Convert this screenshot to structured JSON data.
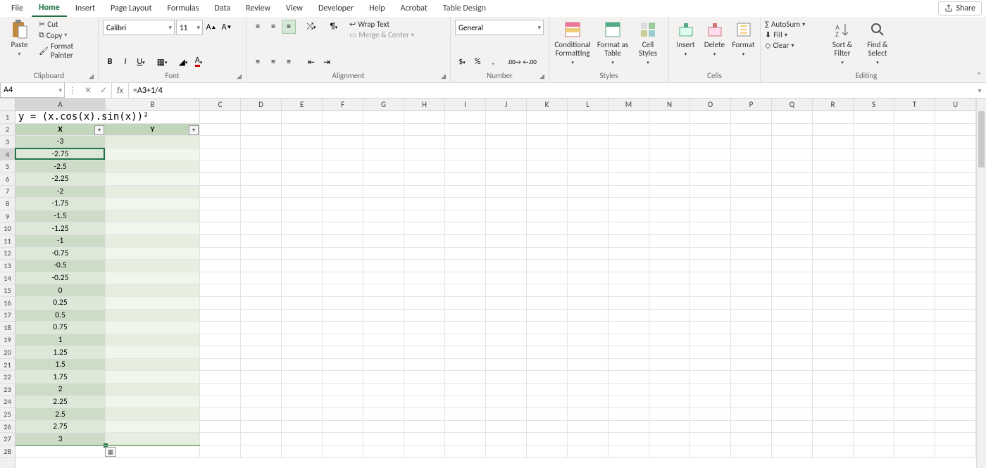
{
  "tabs": {
    "file": "File",
    "home": "Home",
    "insert": "Insert",
    "page_layout": "Page Layout",
    "formulas": "Formulas",
    "data": "Data",
    "review": "Review",
    "view": "View",
    "developer": "Developer",
    "help": "Help",
    "acrobat": "Acrobat",
    "table_design": "Table Design",
    "share": "Share"
  },
  "ribbon": {
    "clipboard": {
      "paste": "Paste",
      "cut": "Cut",
      "copy": "Copy",
      "format_painter": "Format Painter",
      "label": "Clipboard"
    },
    "font": {
      "name": "Calibri",
      "size": "11",
      "label": "Font"
    },
    "alignment": {
      "wrap": "Wrap Text",
      "merge": "Merge & Center",
      "label": "Alignment"
    },
    "number": {
      "format": "General",
      "label": "Number"
    },
    "styles": {
      "conditional": "Conditional Formatting",
      "table": "Format as Table",
      "cell": "Cell Styles",
      "label": "Styles"
    },
    "cells": {
      "insert": "Insert",
      "delete": "Delete",
      "format": "Format",
      "label": "Cells"
    },
    "editing": {
      "autosum": "AutoSum",
      "fill": "Fill",
      "clear": "Clear",
      "sort": "Sort & Filter",
      "find": "Find & Select",
      "label": "Editing"
    }
  },
  "namebox": "A4",
  "formula": "=A3+1/4",
  "columns": [
    "A",
    "B",
    "C",
    "D",
    "E",
    "F",
    "G",
    "H",
    "I",
    "J",
    "K",
    "L",
    "M",
    "N",
    "O",
    "P",
    "Q",
    "R",
    "S",
    "T",
    "U"
  ],
  "colwidths": {
    "A": 128,
    "B": 134,
    "other": 58
  },
  "row_count_visible": 28,
  "table": {
    "title": "y = (x.cos(x).sin(x))²",
    "headers": {
      "x": "X",
      "y": "Y"
    },
    "x_values": [
      "-3",
      "-2.75",
      "-2.5",
      "-2.25",
      "-2",
      "-1.75",
      "-1.5",
      "-1.25",
      "-1",
      "-0.75",
      "-0.5",
      "-0.25",
      "0",
      "0.25",
      "0.5",
      "0.75",
      "1",
      "1.25",
      "1.5",
      "1.75",
      "2",
      "2.25",
      "2.5",
      "2.75",
      "3"
    ]
  },
  "active_cell": "A4",
  "chart_data": {
    "type": "table",
    "title": "y = (x.cos(x).sin(x))²",
    "columns": [
      "X",
      "Y"
    ],
    "x": [
      -3,
      -2.75,
      -2.5,
      -2.25,
      -2,
      -1.75,
      -1.5,
      -1.25,
      -1,
      -0.75,
      -0.5,
      -0.25,
      0,
      0.25,
      0.5,
      0.75,
      1,
      1.25,
      1.5,
      1.75,
      2,
      2.25,
      2.5,
      2.75,
      3
    ],
    "y": []
  }
}
